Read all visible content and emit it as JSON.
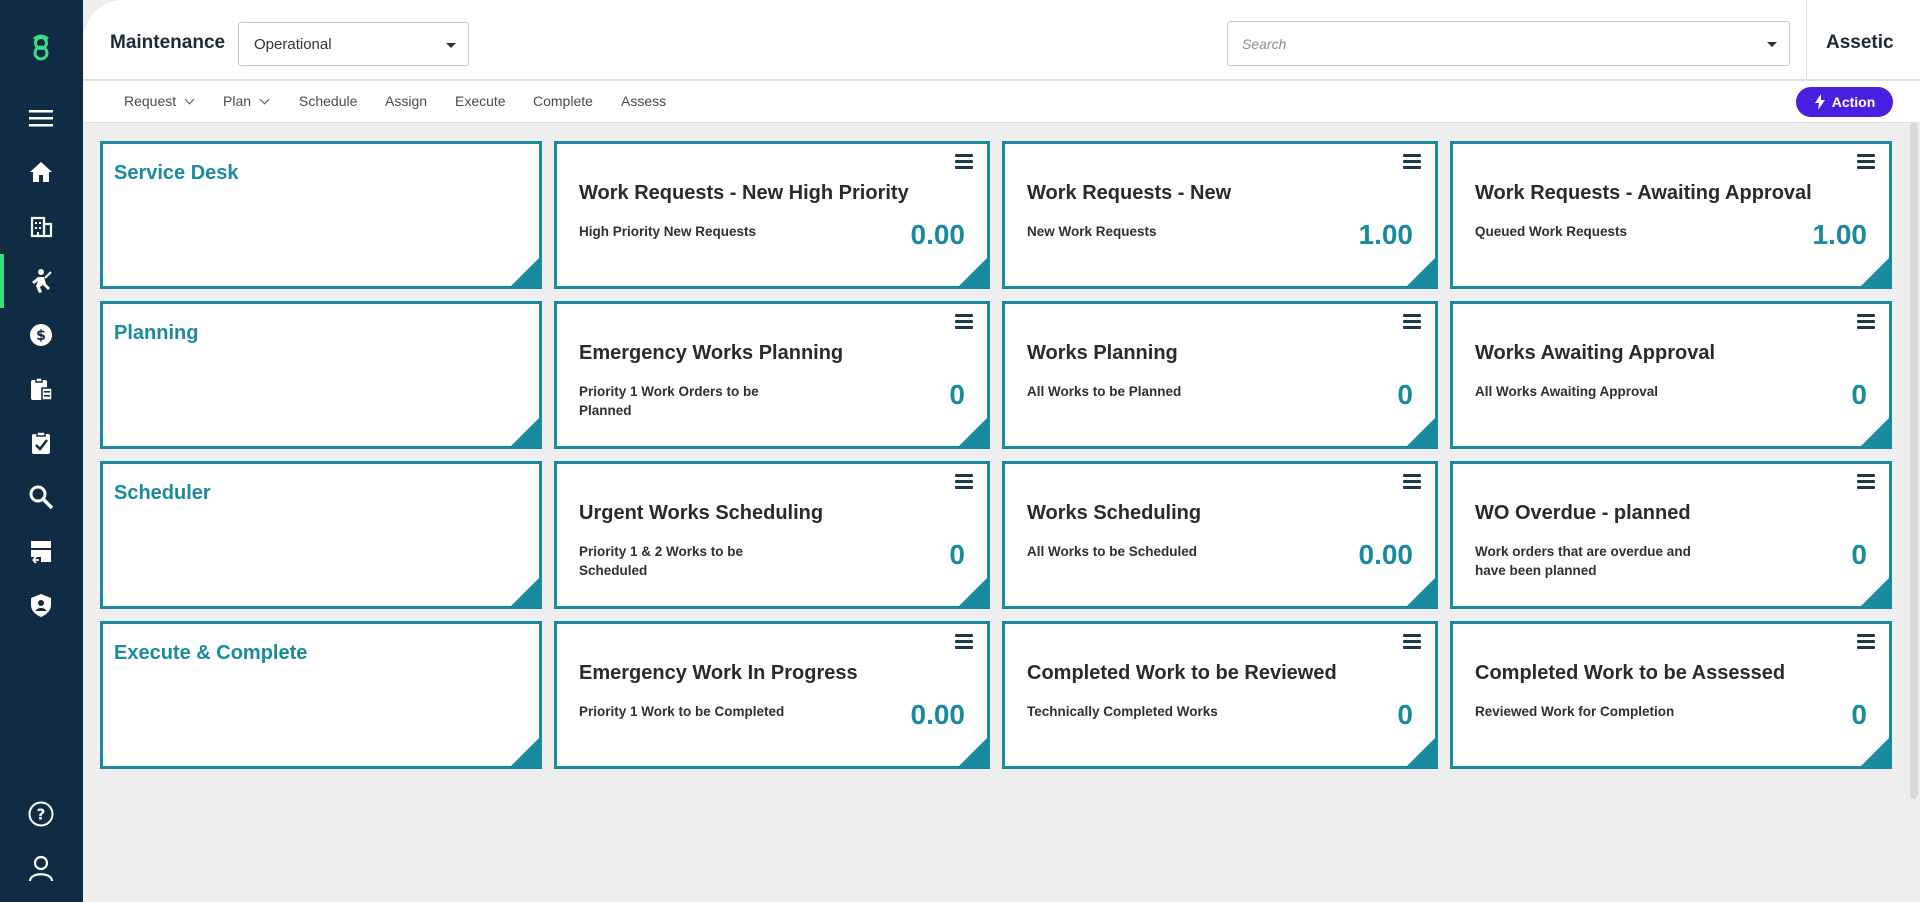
{
  "header": {
    "module_title": "Maintenance",
    "module_select_value": "Operational",
    "search_placeholder": "Search",
    "brand": "Assetic"
  },
  "nav": {
    "items": [
      {
        "label": "Request",
        "dropdown": true
      },
      {
        "label": "Plan",
        "dropdown": true
      },
      {
        "label": "Schedule",
        "dropdown": false
      },
      {
        "label": "Assign",
        "dropdown": false
      },
      {
        "label": "Execute",
        "dropdown": false
      },
      {
        "label": "Complete",
        "dropdown": false
      },
      {
        "label": "Assess",
        "dropdown": false
      }
    ],
    "action_label": "Action"
  },
  "sidebar": {
    "icons": [
      "logo-icon",
      "hamburger-menu-icon",
      "home-icon",
      "building-icon",
      "worker-icon",
      "money-icon",
      "clipboard-icon",
      "checklist-icon",
      "search-icon",
      "storage-icon",
      "shield-icon",
      "help-icon",
      "user-icon"
    ],
    "active": "worker-icon"
  },
  "colors": {
    "sidebar": "#102c44",
    "accent": "#1a8a9e",
    "action": "#4b1fe0",
    "logo": "#3ddc84"
  },
  "groups": [
    {
      "title": "Service Desk"
    },
    {
      "title": "Planning"
    },
    {
      "title": "Scheduler"
    },
    {
      "title": "Execute & Complete"
    }
  ],
  "kpis": [
    [
      {
        "title": "Work Requests - New High Priority",
        "subtitle": "High Priority New Requests",
        "value": "0.00"
      },
      {
        "title": "Work Requests - New",
        "subtitle": "New Work Requests",
        "value": "1.00"
      },
      {
        "title": "Work Requests - Awaiting Approval",
        "subtitle": "Queued Work Requests",
        "value": "1.00"
      }
    ],
    [
      {
        "title": "Emergency Works Planning",
        "subtitle": "Priority 1 Work Orders to be Planned",
        "value": "0"
      },
      {
        "title": "Works Planning",
        "subtitle": "All Works to be Planned",
        "value": "0"
      },
      {
        "title": "Works Awaiting Approval",
        "subtitle": "All Works Awaiting Approval",
        "value": "0"
      }
    ],
    [
      {
        "title": "Urgent Works Scheduling",
        "subtitle": "Priority 1 & 2 Works to be Scheduled",
        "value": "0"
      },
      {
        "title": "Works Scheduling",
        "subtitle": "All Works to be Scheduled",
        "value": "0.00"
      },
      {
        "title": "WO Overdue - planned",
        "subtitle": "Work orders that are overdue and have been planned",
        "value": "0"
      }
    ],
    [
      {
        "title": "Emergency Work In Progress",
        "subtitle": "Priority 1 Work to be Completed",
        "value": "0.00"
      },
      {
        "title": "Completed Work to be Reviewed",
        "subtitle": "Technically Completed Works",
        "value": "0"
      },
      {
        "title": "Completed Work to be Assessed",
        "subtitle": "Reviewed Work for Completion",
        "value": "0"
      }
    ]
  ]
}
